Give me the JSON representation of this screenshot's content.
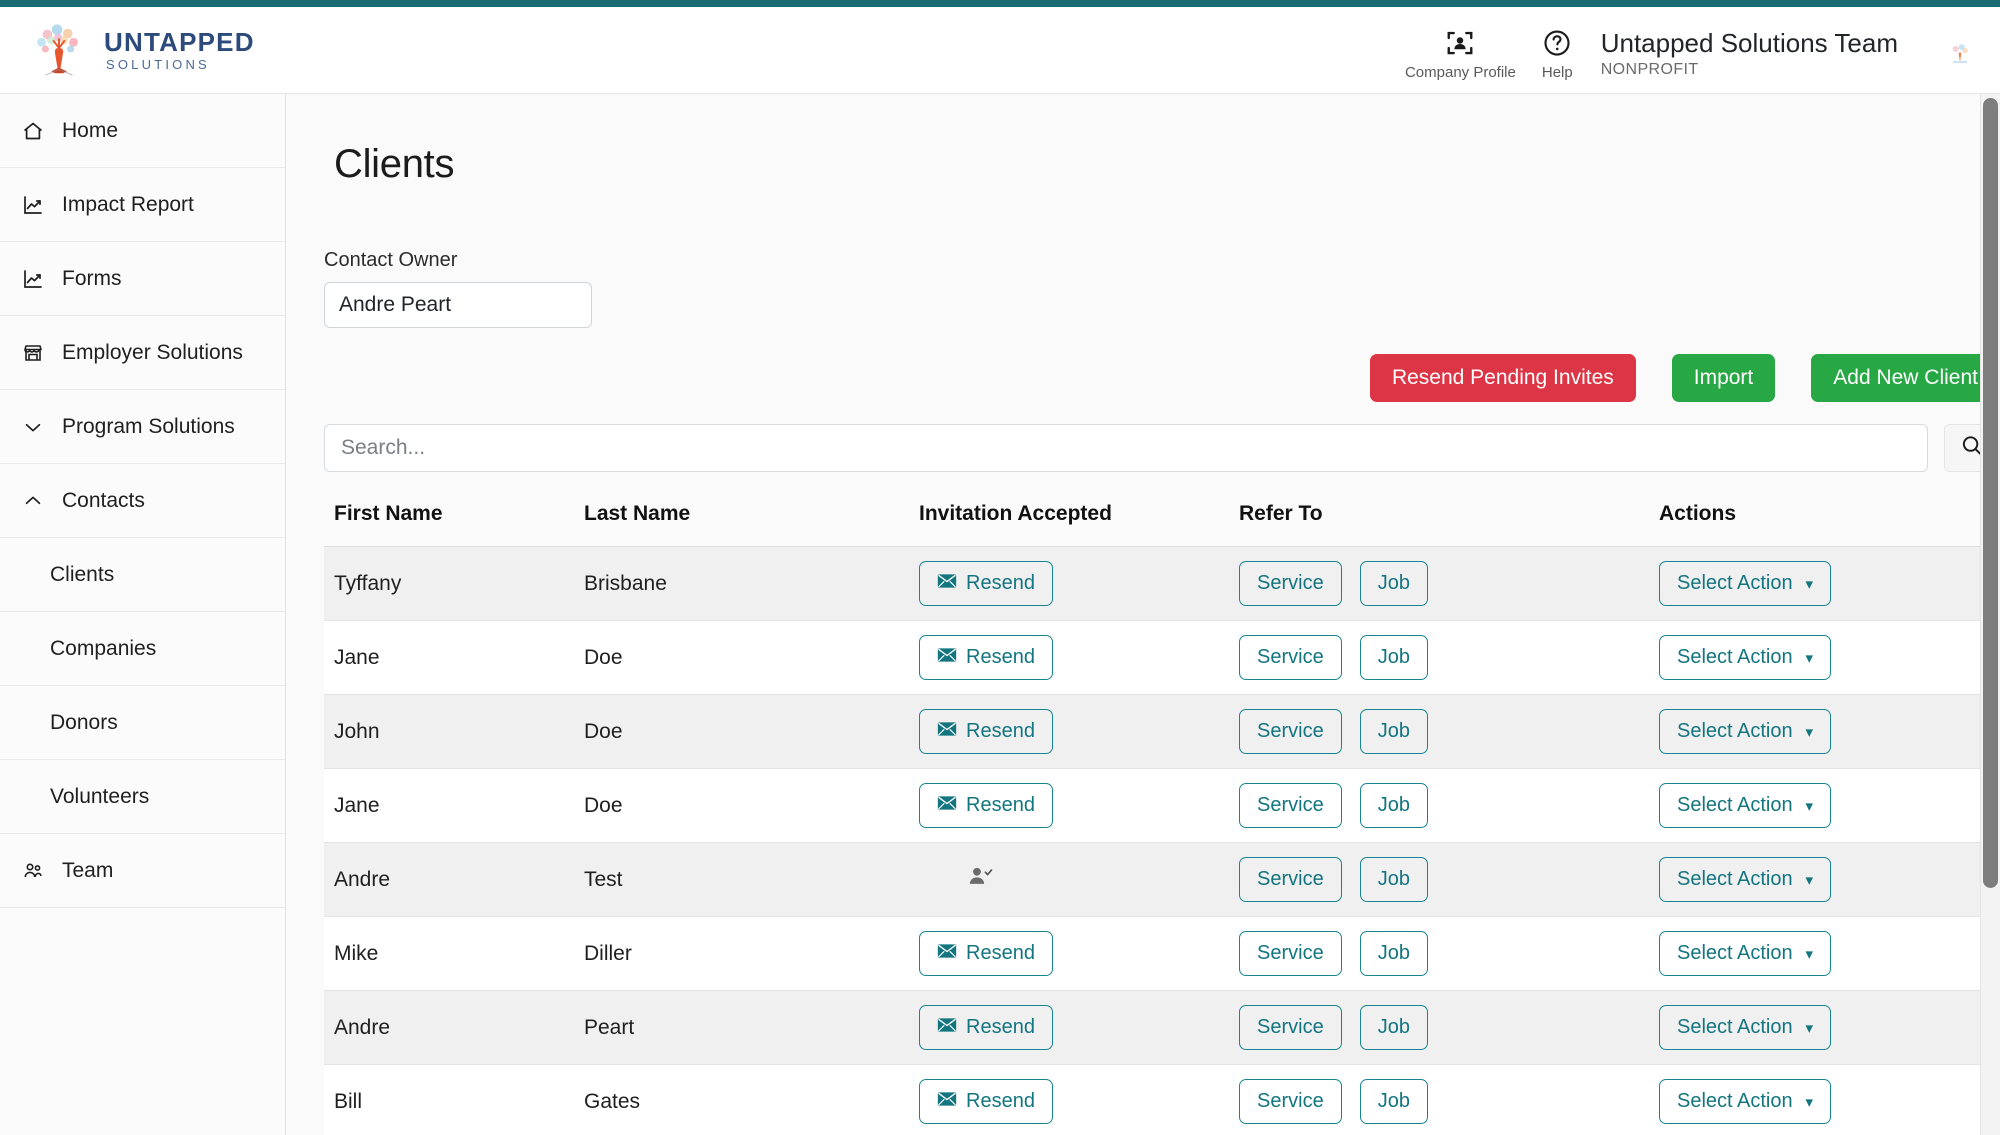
{
  "brand": {
    "title": "UNTAPPED",
    "subtitle": "SOLUTIONS",
    "logo_icon": "tree-logo"
  },
  "header": {
    "company_profile_label": "Company Profile",
    "company_profile_icon": "person-frame-icon",
    "help_label": "Help",
    "help_icon": "question-circle-icon",
    "org_name": "Untapped Solutions Team",
    "org_type": "NONPROFIT",
    "avatar_icon": "tree-avatar"
  },
  "sidebar": {
    "items": [
      {
        "label": "Home",
        "icon": "home-icon",
        "sub": false,
        "chevron": ""
      },
      {
        "label": "Impact Report",
        "icon": "trend-chart-icon",
        "sub": false,
        "chevron": ""
      },
      {
        "label": "Forms",
        "icon": "trend-chart-icon",
        "sub": false,
        "chevron": ""
      },
      {
        "label": "Employer Solutions",
        "icon": "store-icon",
        "sub": false,
        "chevron": ""
      },
      {
        "label": "Program Solutions",
        "icon": "chevron-down-icon",
        "sub": false,
        "chevron": "down"
      },
      {
        "label": "Contacts",
        "icon": "chevron-up-icon",
        "sub": false,
        "chevron": "up"
      },
      {
        "label": "Clients",
        "icon": "",
        "sub": true,
        "chevron": ""
      },
      {
        "label": "Companies",
        "icon": "",
        "sub": true,
        "chevron": ""
      },
      {
        "label": "Donors",
        "icon": "",
        "sub": true,
        "chevron": ""
      },
      {
        "label": "Volunteers",
        "icon": "",
        "sub": true,
        "chevron": ""
      },
      {
        "label": "Team",
        "icon": "people-icon",
        "sub": false,
        "chevron": ""
      }
    ]
  },
  "main": {
    "page_title": "Clients",
    "contact_owner_label": "Contact Owner",
    "contact_owner_value": "Andre Peart",
    "buttons": {
      "resend_pending_invites": "Resend Pending Invites",
      "import": "Import",
      "add_new_client": "Add New Client"
    },
    "search": {
      "placeholder": "Search...",
      "value": "",
      "icon": "search-icon"
    },
    "table": {
      "columns": [
        "First Name",
        "Last Name",
        "Invitation Accepted",
        "Refer To",
        "Actions"
      ],
      "labels": {
        "resend": "Resend",
        "resend_icon": "envelope-icon",
        "service": "Service",
        "job": "Job",
        "select_action": "Select Action",
        "select_action_caret": "▾",
        "accepted_icon": "person-check-icon"
      },
      "rows": [
        {
          "first_name": "Tyffany",
          "last_name": "Brisbane",
          "invitation_accepted": false
        },
        {
          "first_name": "Jane",
          "last_name": "Doe",
          "invitation_accepted": false
        },
        {
          "first_name": "John",
          "last_name": "Doe",
          "invitation_accepted": false
        },
        {
          "first_name": "Jane",
          "last_name": "Doe",
          "invitation_accepted": false
        },
        {
          "first_name": "Andre",
          "last_name": "Test",
          "invitation_accepted": true
        },
        {
          "first_name": "Mike",
          "last_name": "Diller",
          "invitation_accepted": false
        },
        {
          "first_name": "Andre",
          "last_name": "Peart",
          "invitation_accepted": false
        },
        {
          "first_name": "Bill",
          "last_name": "Gates",
          "invitation_accepted": false
        }
      ]
    }
  },
  "colors": {
    "accent_teal": "#1b6b72",
    "btn_teal": "#17858f",
    "danger_red": "#dc3545",
    "success_green": "#28a745",
    "brand_blue": "#2d4a7c"
  }
}
